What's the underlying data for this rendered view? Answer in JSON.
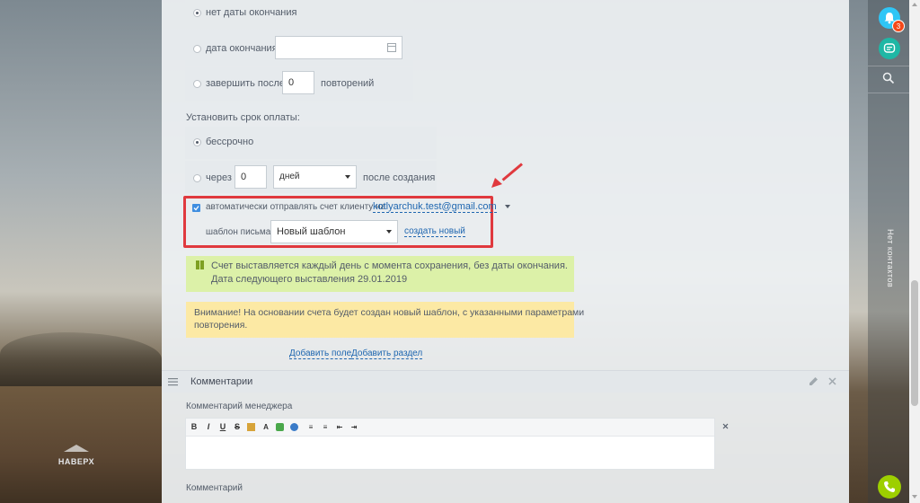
{
  "sidebar": {
    "to_top_label": "НАВЕРХ"
  },
  "right_panel": {
    "notification_count": "3",
    "no_contacts_label": "Нет контактов"
  },
  "end_options": {
    "no_end_date": "нет даты окончания",
    "end_date": "дата окончания",
    "end_date_value": "",
    "finish_after": "завершить после",
    "repeat_count": "0",
    "repeats_label": "повторений"
  },
  "payment": {
    "heading": "Установить срок оплаты:",
    "indefinite": "бессрочно",
    "through": "через",
    "days_value": "0",
    "unit_select": "дней",
    "after_creation": "после создания"
  },
  "auto_send": {
    "checkbox_label": "автоматически отправлять счет клиенту на",
    "email": "kotlyarchuk.test@gmail.com",
    "template_label": "шаблон письма:",
    "template_value": "Новый шаблон",
    "create_new_link": "создать новый"
  },
  "info": {
    "line1": "Счет выставляется каждый день с момента сохранения, без даты окончания.",
    "line2": "Дата следующего выставления 29.01.2019"
  },
  "warning": {
    "line1": "Внимание! На основании счета будет создан новый шаблон, с указанными параметрами",
    "line2": "повторения."
  },
  "actions": {
    "add_field": "Добавить поле",
    "add_section": "Добавить раздел"
  },
  "comments": {
    "section_title": "Комментарии",
    "manager_comment_label": "Комментарий менеджера",
    "comment_label": "Комментарий"
  },
  "colors": {
    "highlight_border": "#e0393e",
    "info_bg": "#dcf1a8",
    "warning_bg": "#fce9a4",
    "link": "#2067b0"
  }
}
